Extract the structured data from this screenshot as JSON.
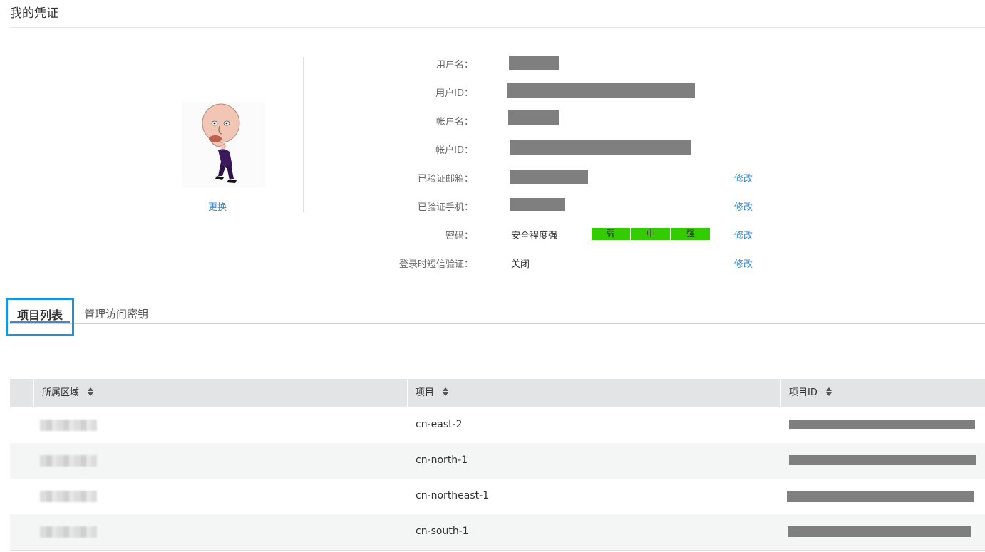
{
  "page": {
    "title": "我的凭证"
  },
  "profile": {
    "change_label": "更换",
    "fields": [
      {
        "label": "用户名："
      },
      {
        "label": "用户ID："
      },
      {
        "label": "帐户名："
      },
      {
        "label": "帐户ID："
      },
      {
        "label": "已验证邮箱：",
        "edit": "修改"
      },
      {
        "label": "已验证手机：",
        "edit": "修改"
      },
      {
        "label": "密码：",
        "value": "安全程度强",
        "edit": "修改",
        "strength": [
          "弱",
          "中",
          "强"
        ],
        "strength_color": "#33cc00"
      },
      {
        "label": "登录时短信验证：",
        "value": "关闭",
        "edit": "修改"
      }
    ]
  },
  "tabs": [
    {
      "label": "项目列表",
      "active": true
    },
    {
      "label": "管理访问密钥",
      "active": false
    }
  ],
  "table": {
    "columns": [
      "所属区域",
      "项目",
      "项目ID"
    ],
    "rows": [
      {
        "project": "cn-east-2"
      },
      {
        "project": "cn-north-1"
      },
      {
        "project": "cn-northeast-1"
      },
      {
        "project": "cn-south-1"
      }
    ]
  },
  "colors": {
    "link": "#3a89d6",
    "highlight_box": "#1a96d4",
    "redaction": "#7f7f7f"
  }
}
